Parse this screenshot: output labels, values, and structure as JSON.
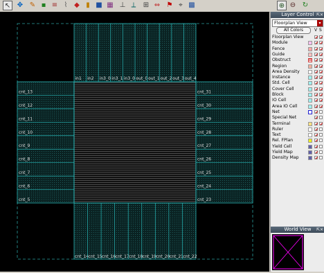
{
  "toolbar": {
    "icons": [
      "select-arrow",
      "move-cross",
      "pencil",
      "shape-tool",
      "layer-stack",
      "wire",
      "route",
      "fill",
      "block",
      "floorplan",
      "measure",
      "ruler",
      "align",
      "stretch",
      "flag",
      "snap",
      "grid",
      "zoom-in",
      "zoom-out",
      "refresh"
    ]
  },
  "canvas": {
    "top_pins": [
      "in1",
      "in2",
      "in3_0",
      "in3_1",
      "in3_0",
      "out_0",
      "out_1",
      "out_2",
      "out_3",
      "out_4"
    ],
    "bottom_pins": [
      "cnt_14",
      "cnt_15",
      "cnt_16",
      "cnt_17",
      "cnt_18",
      "cnt_19",
      "cnt_20",
      "cnt_21",
      "cnt_22"
    ],
    "left_pins": [
      "cnt_13",
      "cnt_12",
      "cnt_11",
      "cnt_10",
      "cnt_9",
      "cnt_8",
      "cnt_7",
      "cnt_6",
      "cnt_5"
    ],
    "right_pins": [
      "cnt_31",
      "cnt_30",
      "cnt_29",
      "cnt_28",
      "cnt_27",
      "cnt_26",
      "cnt_25",
      "cnt_24",
      "cnt_23"
    ]
  },
  "layer_control": {
    "title": "Layer Control",
    "view": "Floorplan View",
    "all_colors_label": "All Colors",
    "v_label": "V",
    "s_label": "S",
    "layers": [
      {
        "name": "Floorplan View",
        "color": "",
        "v": true,
        "s": true
      },
      {
        "name": "Module",
        "color": "#f7c0f0",
        "v": true,
        "s": true
      },
      {
        "name": "Fence",
        "color": "#ffa8a8",
        "v": true,
        "s": true
      },
      {
        "name": "Guide",
        "color": "#ffc0c0",
        "v": true,
        "s": true
      },
      {
        "name": "Obstruct",
        "color": "#d04040",
        "v": true,
        "s": true
      },
      {
        "name": "Region",
        "color": "#f0b0a0",
        "v": true,
        "s": true
      },
      {
        "name": "Area Density",
        "color": "#ffffff",
        "v": true,
        "s": true
      },
      {
        "name": "Instance",
        "color": "#a0f0f0",
        "v": true,
        "s": true
      },
      {
        "name": "Std. Cell",
        "color": "#a0f0f0",
        "v": true,
        "s": true
      },
      {
        "name": "Cover Cell",
        "color": "#a0f0f0",
        "v": true,
        "s": true
      },
      {
        "name": "Block",
        "color": "#a0f0f0",
        "v": true,
        "s": true
      },
      {
        "name": "IO Cell",
        "color": "#a0f0f0",
        "v": true,
        "s": true
      },
      {
        "name": "Area IO Cell",
        "color": "#a0f0f0",
        "v": true,
        "s": true
      },
      {
        "name": "Net",
        "color": "#2020d0",
        "v": true,
        "s": false
      },
      {
        "name": "Special Net",
        "color": "",
        "v": true,
        "s": false
      },
      {
        "name": "Terminal",
        "color": "#ffe080",
        "v": true,
        "s": true
      },
      {
        "name": "Ruler",
        "color": "#ffffff",
        "v": true,
        "s": false
      },
      {
        "name": "Text",
        "color": "#ffffff",
        "v": true,
        "s": false
      },
      {
        "name": "Rel. FPlan",
        "color": "#f0f020",
        "v": true,
        "s": false
      },
      {
        "name": "Yield Cell",
        "color": "#6060a8",
        "v": true,
        "s": false
      },
      {
        "name": "Yield Map",
        "color": "#6060a8",
        "v": true,
        "s": false
      },
      {
        "name": "Density Map",
        "color": "#6060a8",
        "v": true,
        "s": false
      }
    ]
  },
  "world_view": {
    "title": "World View"
  }
}
